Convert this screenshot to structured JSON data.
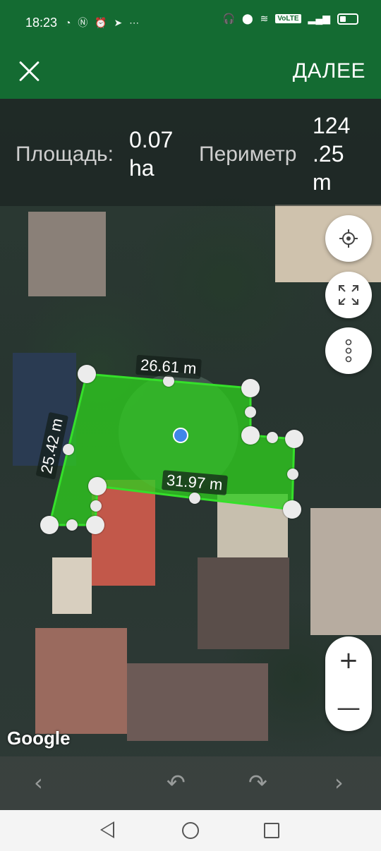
{
  "status_bar": {
    "time": "18:23",
    "left_icons": [
      "speed-icon",
      "nfc-icon",
      "alarm-icon",
      "telegram-icon",
      "olx-icon"
    ],
    "right_icons": [
      "headphones-icon",
      "vibrate-icon",
      "location-icon",
      "wifi-icon",
      "volte-icon",
      "signal-icon",
      "battery-icon"
    ],
    "volte": "VoLTE"
  },
  "header": {
    "next_label": "ДАЛЕЕ",
    "brand_color": "#146b32"
  },
  "measurements": {
    "area_label": "Площадь:",
    "area_value_line1": "0.07",
    "area_value_line2": "ha",
    "perimeter_label": "Периметр",
    "perimeter_value_line1": "124",
    "perimeter_value_line2": ".25",
    "perimeter_value_line3": "m"
  },
  "polygon": {
    "fill_color": "#2ecc1f",
    "edge_labels": [
      "26.61 m",
      "25.42 m",
      "31.97 m"
    ]
  },
  "map": {
    "attribution": "Google"
  },
  "controls": {
    "my_location": "my-location-icon",
    "fit_view": "fit-screen-icon",
    "more": "more-vert-icon",
    "zoom_in": "+",
    "zoom_out": "—"
  },
  "undo_bar": {
    "prev": "‹",
    "undo": "↶",
    "redo": "↷",
    "next": "›"
  }
}
